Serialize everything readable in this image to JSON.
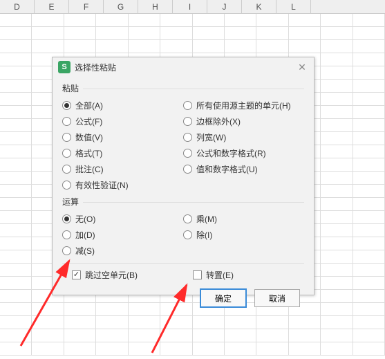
{
  "columns": [
    "D",
    "E",
    "F",
    "G",
    "H",
    "I",
    "J",
    "K",
    "L"
  ],
  "dialog": {
    "title": "选择性粘贴",
    "paste_section": "粘贴",
    "paste_left": [
      {
        "label": "全部(A)",
        "checked": true
      },
      {
        "label": "公式(F)",
        "checked": false
      },
      {
        "label": "数值(V)",
        "checked": false
      },
      {
        "label": "格式(T)",
        "checked": false
      },
      {
        "label": "批注(C)",
        "checked": false
      },
      {
        "label": "有效性验证(N)",
        "checked": false
      }
    ],
    "paste_right": [
      {
        "label": "所有使用源主题的单元(H)",
        "checked": false
      },
      {
        "label": "边框除外(X)",
        "checked": false
      },
      {
        "label": "列宽(W)",
        "checked": false
      },
      {
        "label": "公式和数字格式(R)",
        "checked": false
      },
      {
        "label": "值和数字格式(U)",
        "checked": false
      }
    ],
    "op_section": "运算",
    "op_left": [
      {
        "label": "无(O)",
        "checked": true
      },
      {
        "label": "加(D)",
        "checked": false
      },
      {
        "label": "减(S)",
        "checked": false
      }
    ],
    "op_right": [
      {
        "label": "乘(M)",
        "checked": false
      },
      {
        "label": "除(I)",
        "checked": false
      }
    ],
    "skip_blanks": {
      "label": "跳过空单元(B)",
      "checked": true
    },
    "transpose": {
      "label": "转置(E)",
      "checked": false
    },
    "ok": "确定",
    "cancel": "取消"
  }
}
